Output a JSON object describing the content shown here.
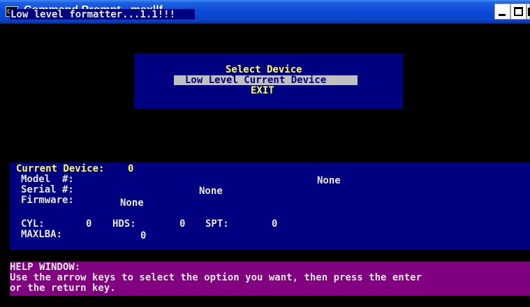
{
  "window": {
    "title": "Command Prompt - maxllf",
    "icon_text": "C:\\",
    "icons": [
      "console-app-icon",
      "minimize-icon",
      "maximize-icon",
      "close-icon"
    ]
  },
  "console": {
    "heading": "Low level formatter...1.1!!!",
    "menu": {
      "title": "Select Device",
      "selected_item": "Low Level Current Device",
      "exit_item": "EXIT"
    },
    "device": {
      "current_label": "Current Device:",
      "current_value": "0",
      "model_label": "Model  #:",
      "model_value": "None",
      "serial_label": "Serial #:",
      "serial_value": "None",
      "firmware_label": "Firmware:",
      "firmware_value": "None",
      "cyl_label": "CYL:",
      "cyl_value": "0",
      "hds_label": "HDS:",
      "hds_value": "0",
      "spt_label": "SPT:",
      "spt_value": "0",
      "maxlba_label": "MAXLBA:",
      "maxlba_value": "0"
    },
    "help": {
      "title": "HELP WINDOW:",
      "line1": "Use the arrow keys to select the option you want, then press the enter",
      "line2": "or the return key."
    }
  },
  "colors": {
    "title_bar": "#0a4bd6",
    "console_bg": "#000000",
    "panel_blue": "#000080",
    "help_purple": "#800080",
    "text_white": "#e8e8e8",
    "text_yellow": "#ffff55",
    "menu_highlight": "#c0c0c0"
  }
}
